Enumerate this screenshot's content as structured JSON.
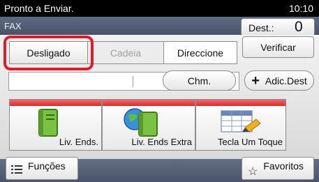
{
  "status_bar": {
    "status": "Pronto a Enviar.",
    "time": "10:10"
  },
  "header": {
    "title": "FAX",
    "dest_label": "Dest.:",
    "dest_count": "0"
  },
  "controls": {
    "off_label": "Desligado",
    "chain_label": "Cadeia",
    "address_label": "Direccione",
    "verify_label": "Verificar",
    "chm_label": "Chm.",
    "add_dest_label": "Adic.Dest"
  },
  "tiles": [
    {
      "label": "Liv. Ends."
    },
    {
      "label": "Liv. Ends Extra"
    },
    {
      "label": "Tecla Um Toque"
    }
  ],
  "bottom": {
    "functions_label": "Funções",
    "favorites_label": "Favoritos"
  },
  "colors": {
    "highlight": "#e01c2b",
    "header": "#55607a",
    "tile_bar": "#e03a3a"
  }
}
